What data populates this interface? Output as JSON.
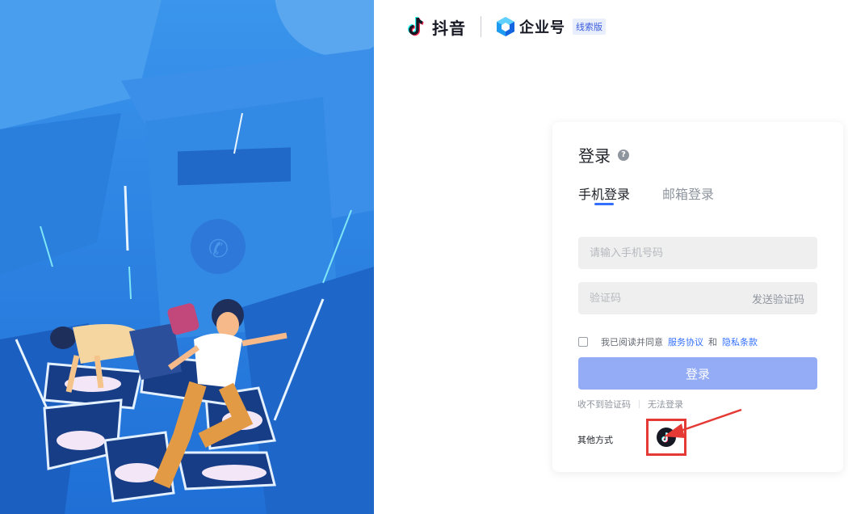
{
  "brand": {
    "douyin_name": "抖音",
    "enterprise_name": "企业号",
    "badge": "线索版"
  },
  "login": {
    "title": "登录",
    "help_icon": "?",
    "tabs": [
      {
        "label": "手机登录",
        "active": true
      },
      {
        "label": "邮箱登录",
        "active": false
      }
    ],
    "phone_placeholder": "请输入手机号码",
    "code_placeholder": "验证码",
    "send_code": "发送验证码",
    "agree_prefix": "我已阅读并同意",
    "service_agreement": "服务协议",
    "and": "和",
    "privacy_terms": "隐私条款",
    "submit": "登录",
    "no_code": "收不到验证码",
    "cannot_login": "无法登录",
    "other_methods": "其他方式"
  },
  "colors": {
    "accent": "#3370ff",
    "button_disabled": "#93acf5",
    "highlight": "#e53935",
    "illustration_bg": "#2e86e6"
  },
  "icons": [
    "douyin-logo-icon",
    "enterprise-logo-icon",
    "help-icon",
    "douyin-login-icon",
    "red-arrow-icon"
  ]
}
